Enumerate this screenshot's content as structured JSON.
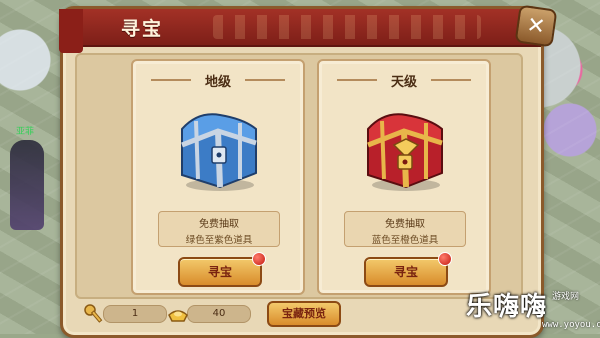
{
  "window": {
    "title": "寻宝"
  },
  "cards": [
    {
      "tier": "地级",
      "free_text": "免费抽取",
      "range_text": "绿色至紫色道具",
      "button_label": "寻宝",
      "chest_color": "#4a8fd6"
    },
    {
      "tier": "天级",
      "free_text": "免费抽取",
      "range_text": "蓝色至橙色道具",
      "button_label": "寻宝",
      "chest_color": "#c8282a"
    }
  ],
  "resources": {
    "key_count": "1",
    "gold_count": "40"
  },
  "footer": {
    "preview_label": "宝藏预览"
  },
  "scene": {
    "character_name": "亚菲"
  },
  "watermark": {
    "brand": "乐嗨嗨",
    "site": "www.yoyou.com",
    "side_text": "游戏网"
  },
  "colors": {
    "accent_red": "#a33126",
    "button_gold": "#f3c96b",
    "panel_bg": "#e8d8b6"
  }
}
